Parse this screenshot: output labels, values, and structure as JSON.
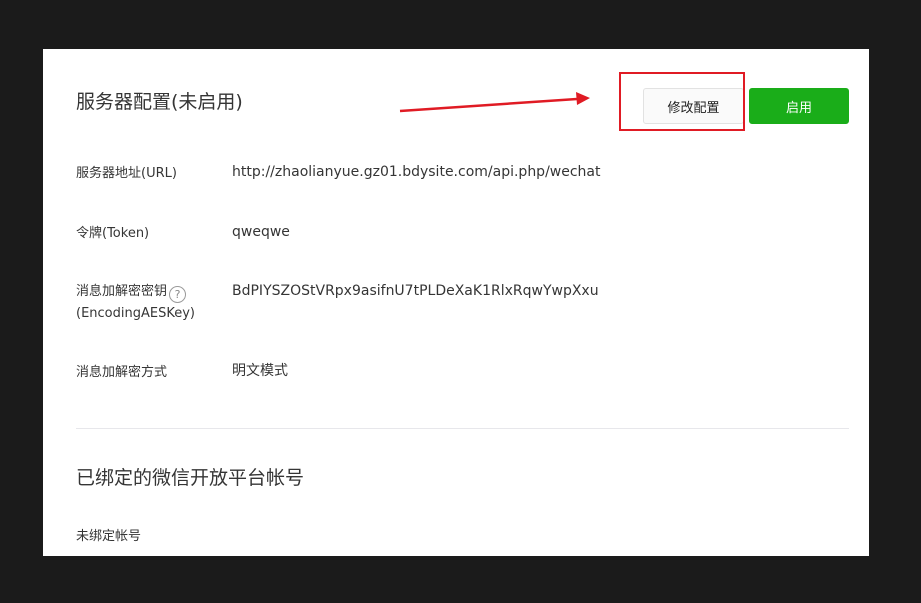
{
  "server_config": {
    "title": "服务器配置(未启用)",
    "edit_button": "修改配置",
    "enable_button": "启用",
    "fields": [
      {
        "label": "服务器地址(URL)",
        "value": "http://zhaolianyue.gz01.bdysite.com/api.php/wechat"
      },
      {
        "label": "令牌(Token)",
        "value": "qweqwe"
      },
      {
        "label_line1": "消息加解密密钥",
        "label_line2": "(EncodingAESKey)",
        "value": "BdPIYSZOStVRpx9asifnU7tPLDeXaK1RlxRqwYwpXxu"
      },
      {
        "label": "消息加解密方式",
        "value": "明文模式"
      }
    ]
  },
  "bound_accounts": {
    "title": "已绑定的微信开放平台帐号",
    "status": "未绑定帐号"
  },
  "icons": {
    "help": "?"
  },
  "colors": {
    "enable_green": "#1aad19",
    "annotation_red": "#e01b24"
  }
}
